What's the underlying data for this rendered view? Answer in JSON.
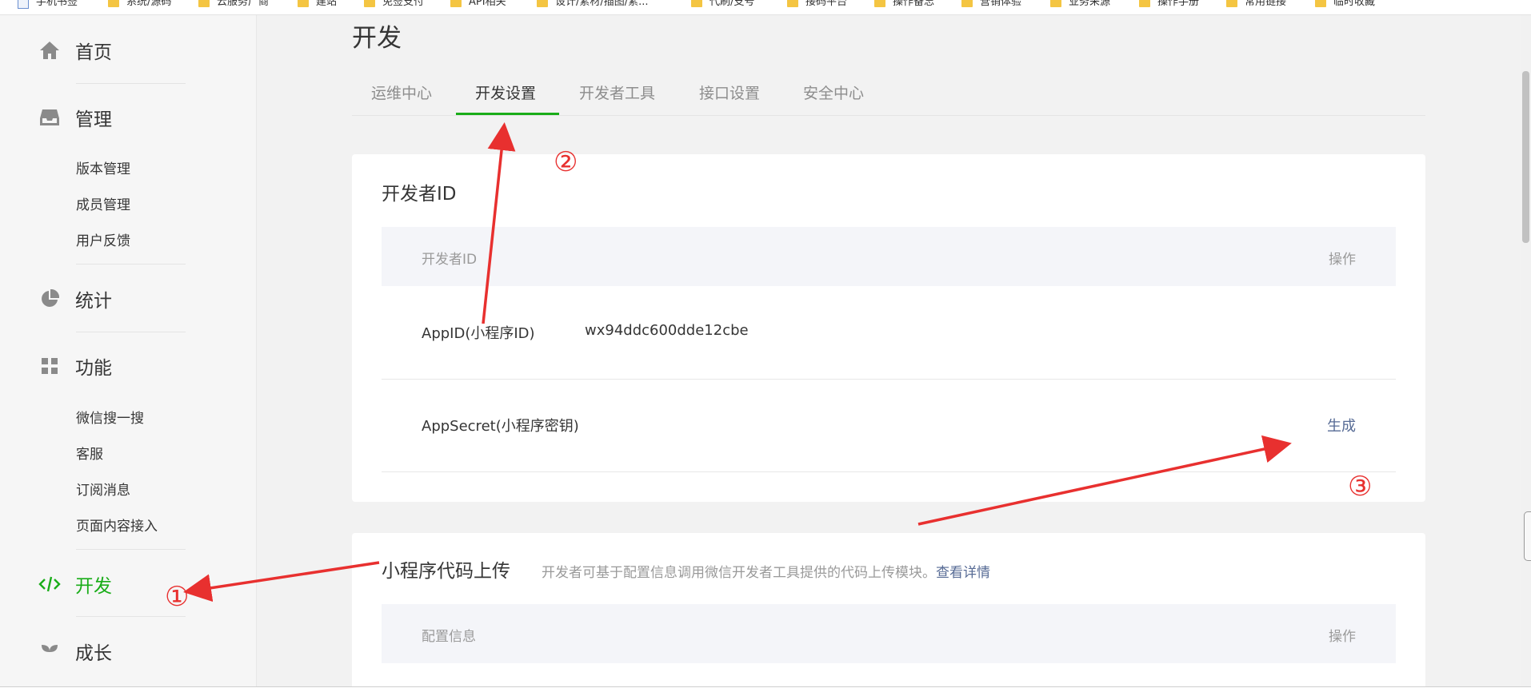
{
  "bookmarks": [
    {
      "label": "手机书签",
      "kind": "page"
    },
    {
      "label": "系统/源码",
      "kind": "folder"
    },
    {
      "label": "云服务厂商",
      "kind": "folder"
    },
    {
      "label": "建站",
      "kind": "folder"
    },
    {
      "label": "免签支付",
      "kind": "folder"
    },
    {
      "label": "API相关",
      "kind": "folder"
    },
    {
      "label": "设计/素材/插图/素...",
      "kind": "folder"
    },
    {
      "label": "代刷/支号",
      "kind": "folder"
    },
    {
      "label": "接码平台",
      "kind": "folder"
    },
    {
      "label": "操作备忘",
      "kind": "folder"
    },
    {
      "label": "营销体验",
      "kind": "folder"
    },
    {
      "label": "业务采源",
      "kind": "folder"
    },
    {
      "label": "操作手册",
      "kind": "folder"
    },
    {
      "label": "常用链接",
      "kind": "folder"
    },
    {
      "label": "临时收藏",
      "kind": "folder"
    }
  ],
  "sidebar": {
    "home": "首页",
    "manage": "管理",
    "manage_items": [
      "版本管理",
      "成员管理",
      "用户反馈"
    ],
    "stats": "统计",
    "features": "功能",
    "feature_items": [
      "微信搜一搜",
      "客服",
      "订阅消息",
      "页面内容接入"
    ],
    "develop": "开发",
    "growth": "成长"
  },
  "page_title": "开发",
  "tabs": [
    "运维中心",
    "开发设置",
    "开发者工具",
    "接口设置",
    "安全中心"
  ],
  "active_tab": "开发设置",
  "developer_id": {
    "title": "开发者ID",
    "header_left": "开发者ID",
    "header_right": "操作",
    "appid_label": "AppID(小程序ID)",
    "appid_value": "wx94ddc600dde12cbe",
    "secret_label": "AppSecret(小程序密钥)",
    "secret_action": "生成"
  },
  "upload": {
    "title": "小程序代码上传",
    "desc": "开发者可基于配置信息调用微信开发者工具提供的代码上传模块。",
    "link": "查看详情",
    "header_left": "配置信息",
    "header_right": "操作"
  },
  "annotations": [
    "①",
    "②",
    "③"
  ],
  "colors": {
    "accent": "#1aad19",
    "link": "#576b95",
    "arrow": "#e8302f"
  }
}
